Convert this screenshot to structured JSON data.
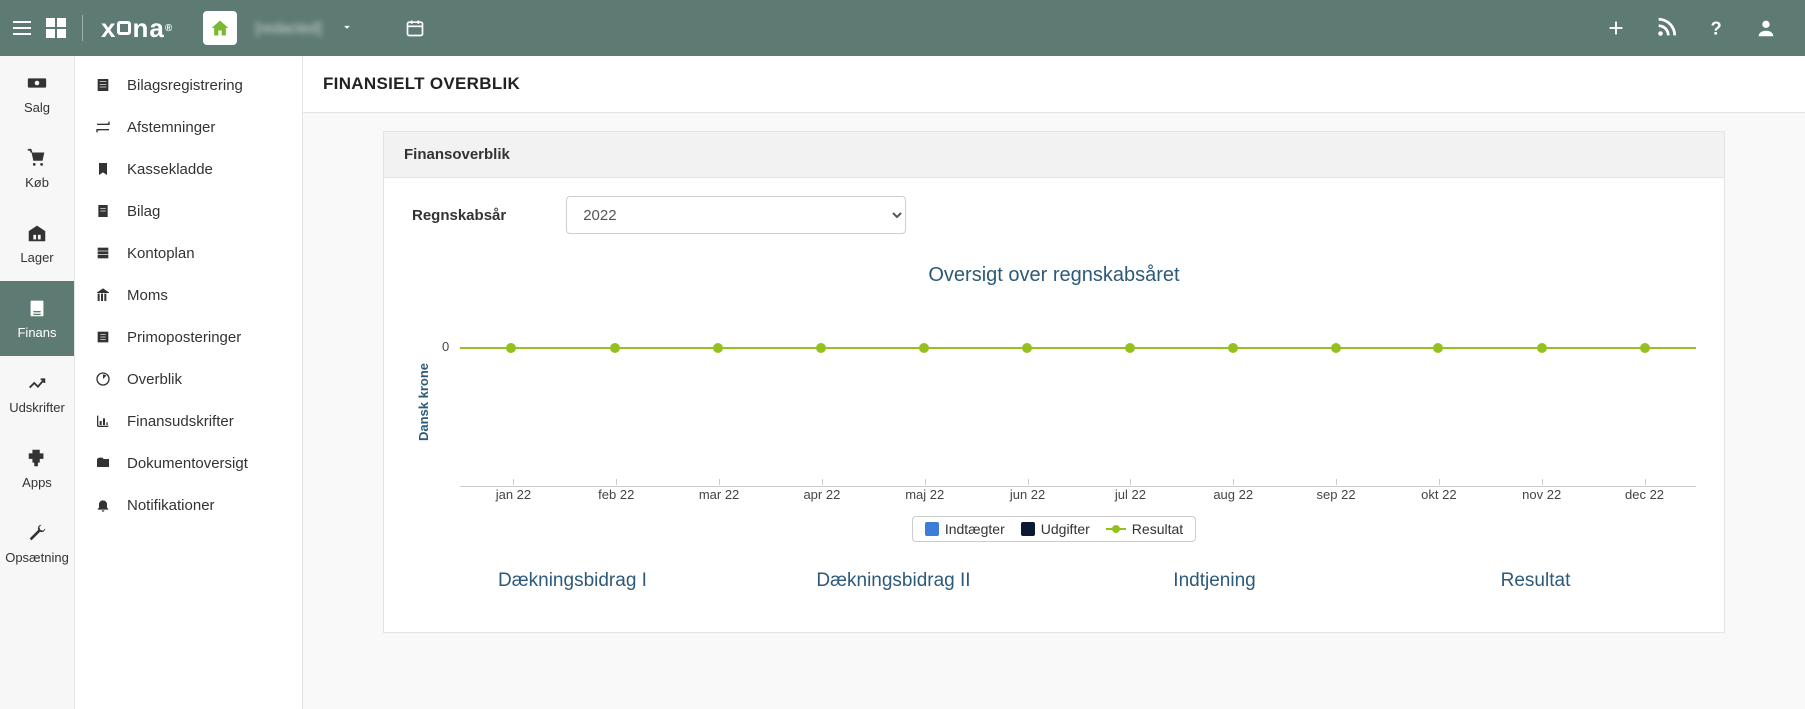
{
  "header": {
    "company_placeholder": "[redacted]"
  },
  "nav1": [
    {
      "label": "Salg",
      "name": "sales"
    },
    {
      "label": "Køb",
      "name": "purchase"
    },
    {
      "label": "Lager",
      "name": "inventory"
    },
    {
      "label": "Finans",
      "name": "finance",
      "active": true
    },
    {
      "label": "Udskrifter",
      "name": "reports"
    },
    {
      "label": "Apps",
      "name": "apps"
    },
    {
      "label": "Opsætning",
      "name": "setup"
    }
  ],
  "nav2": [
    {
      "label": "Bilagsregistrering",
      "name": "voucher-entry"
    },
    {
      "label": "Afstemninger",
      "name": "reconciliations"
    },
    {
      "label": "Kassekladde",
      "name": "journal"
    },
    {
      "label": "Bilag",
      "name": "vouchers"
    },
    {
      "label": "Kontoplan",
      "name": "chart-of-accounts"
    },
    {
      "label": "Moms",
      "name": "vat"
    },
    {
      "label": "Primoposteringer",
      "name": "opening-entries"
    },
    {
      "label": "Overblik",
      "name": "overview"
    },
    {
      "label": "Finansudskrifter",
      "name": "finance-reports"
    },
    {
      "label": "Dokumentoversigt",
      "name": "document-overview"
    },
    {
      "label": "Notifikationer",
      "name": "notifications"
    }
  ],
  "content": {
    "title": "FINANSIELT OVERBLIK",
    "panel_title": "Finansoverblik",
    "year_label": "Regnskabsår",
    "year_value": "2022"
  },
  "chart_data": {
    "type": "line",
    "title": "Oversigt over regnskabsåret",
    "ylabel": "Dansk krone",
    "categories": [
      "jan 22",
      "feb 22",
      "mar 22",
      "apr 22",
      "maj 22",
      "jun 22",
      "jul 22",
      "aug 22",
      "sep 22",
      "okt 22",
      "nov 22",
      "dec 22"
    ],
    "series": [
      {
        "name": "Indtægter",
        "color": "#3b7dd8",
        "values": [
          0,
          0,
          0,
          0,
          0,
          0,
          0,
          0,
          0,
          0,
          0,
          0
        ]
      },
      {
        "name": "Udgifter",
        "color": "#0a1a33",
        "values": [
          0,
          0,
          0,
          0,
          0,
          0,
          0,
          0,
          0,
          0,
          0,
          0
        ]
      },
      {
        "name": "Resultat",
        "color": "#95c11f",
        "values": [
          0,
          0,
          0,
          0,
          0,
          0,
          0,
          0,
          0,
          0,
          0,
          0
        ]
      }
    ],
    "ylim": [
      0,
      0
    ],
    "y_ticks": [
      0
    ]
  },
  "summary_labels": [
    "Dækningsbidrag I",
    "Dækningsbidrag II",
    "Indtjening",
    "Resultat"
  ]
}
